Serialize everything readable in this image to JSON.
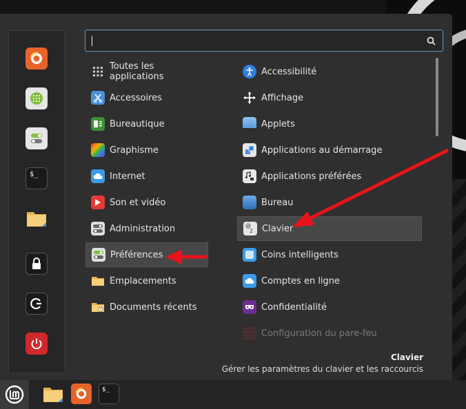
{
  "search": {
    "placeholder": "",
    "value": ""
  },
  "favorites": [
    {
      "name": "firefox-icon",
      "color": "#e8632c"
    },
    {
      "name": "software-manager-icon",
      "color": "#e6e6e6"
    },
    {
      "name": "system-settings-icon",
      "color": "#e6e6e6"
    },
    {
      "name": "terminal-icon",
      "color": "#1a1a1a"
    },
    {
      "name": "files-folder-icon",
      "color": "#f2c36b"
    },
    {
      "name": "lock-screen-icon",
      "color": "#1a1a1a"
    },
    {
      "name": "logout-icon",
      "color": "#1a1a1a"
    },
    {
      "name": "shutdown-icon",
      "color": "#d0282b"
    }
  ],
  "categories_left": [
    {
      "label": "Toutes les applications"
    },
    {
      "label": "Accessoires"
    },
    {
      "label": "Bureautique"
    },
    {
      "label": "Graphisme"
    },
    {
      "label": "Internet"
    },
    {
      "label": "Son et vidéo"
    },
    {
      "label": "Administration"
    },
    {
      "label": "Préférences"
    },
    {
      "label": "Emplacements"
    },
    {
      "label": "Documents récents"
    }
  ],
  "apps_right": [
    {
      "label": "Accessibilité"
    },
    {
      "label": "Affichage"
    },
    {
      "label": "Applets"
    },
    {
      "label": "Applications au démarrage"
    },
    {
      "label": "Applications préférées"
    },
    {
      "label": "Bureau"
    },
    {
      "label": "Clavier"
    },
    {
      "label": "Coins intelligents"
    },
    {
      "label": "Comptes en ligne"
    },
    {
      "label": "Confidentialité"
    },
    {
      "label": "Configuration du pare-feu"
    }
  ],
  "description": {
    "title": "Clavier",
    "text": "Gérer les paramètres du clavier et les raccourcis"
  },
  "colors": {
    "accent": "#62a0c8",
    "arrow": "#e8141b",
    "selected_bg": "#474747"
  }
}
